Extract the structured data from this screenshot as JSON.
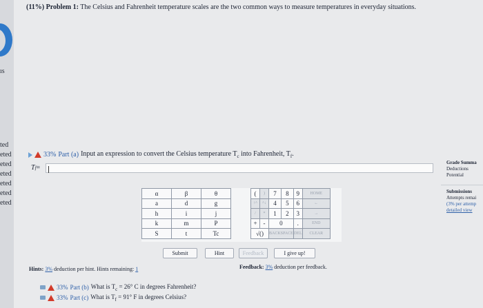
{
  "problem": {
    "percent": "(11%)",
    "label": "Problem 1:",
    "text": "The Celsius and Fahrenheit temperature scales are the two common ways to measure temperatures in everyday situations."
  },
  "left_strip": {
    "top_label": "ıs",
    "items": [
      "ted",
      "eted",
      "eted",
      "eted",
      "eted",
      "eted",
      "eted"
    ]
  },
  "part_a": {
    "percent": "33%",
    "label": "Part (a)",
    "prompt": "Input an expression to convert the Celsius temperature T",
    "sub_c": "c",
    "prompt2": " into Fahrenheit, T",
    "sub_f": "f",
    "end": ".",
    "answer_label": "T",
    "answer_label_sub": "f",
    "answer_eq": " = "
  },
  "keypad": {
    "greek_rows": [
      [
        "α",
        "β",
        "θ"
      ],
      [
        "a",
        "d",
        "g"
      ],
      [
        "h",
        "i",
        "j"
      ],
      [
        "k",
        "m",
        "P"
      ],
      [
        "S",
        "t",
        "Tc"
      ]
    ],
    "row1": [
      "(",
      ")",
      "7",
      "8",
      "9",
      "HOME"
    ],
    "row2": [
      "↑^",
      "^↓",
      "4",
      "5",
      "6",
      "←"
    ],
    "row3": [
      "/",
      "*",
      "1",
      "2",
      "3",
      "→"
    ],
    "row4": [
      "+",
      "-",
      "0",
      ".",
      "END"
    ],
    "row5": [
      "√()",
      "BACKSPACE",
      "DEL",
      "CLEAR"
    ]
  },
  "buttons": {
    "submit": "Submit",
    "hint": "Hint",
    "feedback": "Feedback",
    "give_up": "I give up!"
  },
  "hints": {
    "prefix": "Hints: ",
    "percent": "3%",
    "text": " deduction per hint. Hints remaining: ",
    "remaining": "1"
  },
  "feedback": {
    "prefix": "Feedback: ",
    "percent": "3%",
    "text": " deduction per feedback."
  },
  "part_b": {
    "percent": "33%",
    "label": "Part (b)",
    "text": "What is T",
    "sub": "c",
    "text2": " = 26° C in degrees Fahrenheit?"
  },
  "part_c": {
    "percent": "33%",
    "label": "Part (c)",
    "text": "What is T",
    "sub": "f",
    "text2": " = 91° F in degrees Celsius?"
  },
  "sidebar": {
    "grade_title": "Grade Summa",
    "deductions": "Deductions",
    "potential": "Potential",
    "submissions_title": "Submissions",
    "attempts": "Attempts remai",
    "per_attempt": "(3% per attemp",
    "detailed": "detailed view"
  }
}
